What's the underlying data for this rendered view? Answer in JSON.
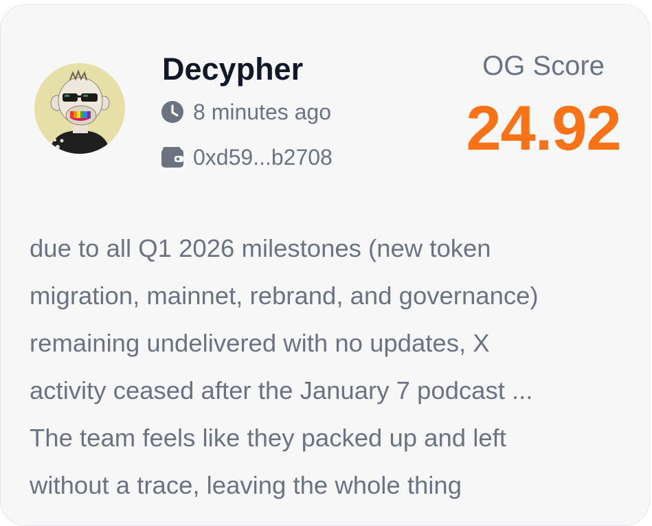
{
  "post": {
    "username": "Decypher",
    "time_ago": "8 minutes ago",
    "wallet_address": "0xd59...b2708",
    "score_label": "OG Score",
    "score_value": "24.92",
    "comment_lines": [
      "due to all Q1 2026 milestones (new token",
      "migration, mainnet, rebrand, and governance)",
      "remaining undelivered with no updates, X",
      "activity ceased after the January 7 podcast ...",
      "The team feels like they packed up and left",
      "without a trace, leaving the whole thing"
    ]
  },
  "icons": {
    "time": "clock-icon",
    "wallet": "wallet-icon",
    "avatar": "ape-avatar"
  },
  "colors": {
    "score": "#f97316",
    "username": "#111827",
    "muted_text": "#6b7280",
    "card_background": "#f7f7f8",
    "avatar_background": "#e6e0a8"
  }
}
